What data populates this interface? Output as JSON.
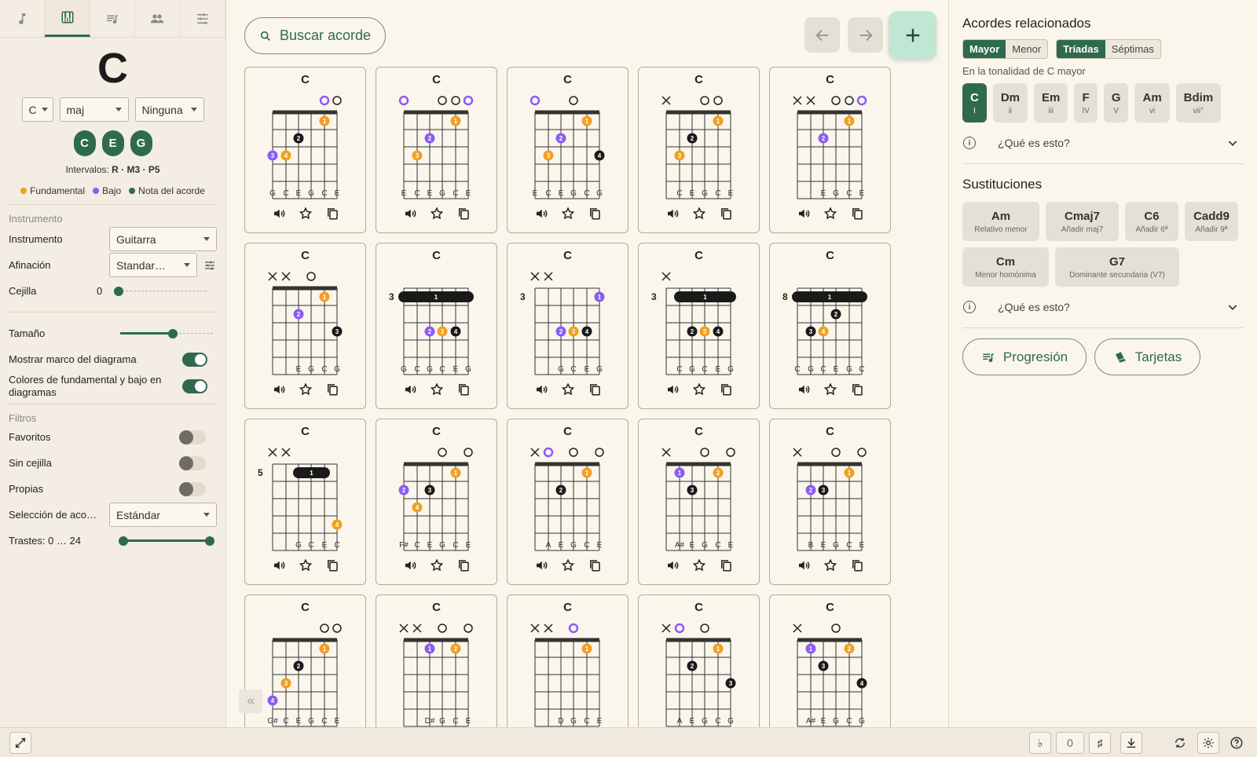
{
  "sidebar": {
    "chord_display": "C",
    "root_select": "C",
    "quality_select": "maj",
    "bass_select": "Ninguna",
    "chord_notes": [
      "C",
      "E",
      "G"
    ],
    "intervals_label": "Intervalos:",
    "intervals_value": "R · M3 · P5",
    "legend": {
      "root": "Fundamental",
      "bass": "Bajo",
      "note": "Nota del acorde"
    },
    "section_instrument": "Instrumento",
    "instrument_label": "Instrumento",
    "instrument_value": "Guitarra",
    "tuning_label": "Afinación",
    "tuning_value": "Standar…",
    "capo_label": "Cejilla",
    "capo_value": "0",
    "size_label": "Tamaño",
    "size_level": 0.57,
    "show_frame_label": "Mostrar marco del diagrama",
    "show_frame": true,
    "colors_label": "Colores de fundamental y bajo en diagramas",
    "colors_on": true,
    "section_filters": "Filtros",
    "favorites_label": "Favoritos",
    "favorites": false,
    "no_barre_label": "Sin cejilla",
    "no_barre": false,
    "own_label": "Propias",
    "own": false,
    "selection_label": "Selección de aco…",
    "selection_value": "Estándar",
    "frets_label": "Trastes: 0 … 24",
    "frets_range": [
      0,
      24
    ]
  },
  "toolbar": {
    "search_label": "Buscar acorde",
    "back_icon": "arrow-left-icon",
    "forward_icon": "arrow-right-icon",
    "add_icon": "plus-icon"
  },
  "colors": {
    "accent": "#2f6a4f",
    "root": "#f0a020",
    "bass": "#8b5cf6",
    "note": "#1a1a1a",
    "background": "#fbf6ec"
  },
  "diagrams": [
    {
      "name": "C",
      "base_fret": null,
      "markers": [
        "",
        "",
        "",
        "",
        "o",
        "o"
      ],
      "bass_open": 4,
      "barre": null,
      "dots": [
        [
          5,
          1,
          1,
          "r"
        ],
        [
          3,
          2,
          2,
          "n"
        ],
        [
          1,
          3,
          3,
          "b"
        ],
        [
          2,
          3,
          4,
          "r"
        ]
      ],
      "notes": [
        "G",
        "C",
        "E",
        "G",
        "C",
        "E"
      ]
    },
    {
      "name": "C",
      "base_fret": null,
      "markers": [
        "o",
        "",
        "",
        "o",
        "o",
        ""
      ],
      "bass_open": 0,
      "bass_open2": 5,
      "barre": null,
      "dots": [
        [
          5,
          1,
          1,
          "r"
        ],
        [
          3,
          2,
          2,
          "b"
        ],
        [
          2,
          3,
          3,
          "r"
        ]
      ],
      "notes": [
        "E",
        "C",
        "E",
        "G",
        "C",
        "E"
      ]
    },
    {
      "name": "C",
      "base_fret": null,
      "markers": [
        "o",
        "",
        "",
        "o",
        "",
        ""
      ],
      "bass_open": 0,
      "barre": null,
      "dots": [
        [
          5,
          1,
          1,
          "r"
        ],
        [
          3,
          2,
          2,
          "b"
        ],
        [
          2,
          3,
          3,
          "r"
        ],
        [
          6,
          3,
          4,
          "n"
        ]
      ],
      "notes": [
        "E",
        "C",
        "E",
        "G",
        "C",
        "G"
      ]
    },
    {
      "name": "C",
      "base_fret": null,
      "markers": [
        "x",
        "",
        "",
        "o",
        "o",
        ""
      ],
      "barre": null,
      "dots": [
        [
          5,
          1,
          1,
          "r"
        ],
        [
          3,
          2,
          2,
          "n"
        ],
        [
          2,
          3,
          3,
          "r"
        ]
      ],
      "notes": [
        "",
        "C",
        "E",
        "G",
        "C",
        "E"
      ]
    },
    {
      "name": "C",
      "base_fret": null,
      "markers": [
        "x",
        "x",
        "",
        "o",
        "o",
        ""
      ],
      "bass_open": 5,
      "barre": null,
      "dots": [
        [
          5,
          1,
          1,
          "r"
        ],
        [
          3,
          2,
          2,
          "b"
        ]
      ],
      "notes": [
        "",
        "",
        "E",
        "G",
        "C",
        "E"
      ]
    },
    {
      "name": "C",
      "base_fret": null,
      "markers": [
        "x",
        "x",
        "",
        "o",
        "",
        ""
      ],
      "barre": null,
      "dots": [
        [
          5,
          1,
          1,
          "r"
        ],
        [
          3,
          2,
          2,
          "b"
        ],
        [
          6,
          3,
          3,
          "n"
        ]
      ],
      "notes": [
        "",
        "",
        "E",
        "G",
        "C",
        "G"
      ]
    },
    {
      "name": "C",
      "base_fret": 3,
      "markers": [
        "",
        "",
        "",
        "",
        "",
        ""
      ],
      "barre": [
        1,
        1,
        6
      ],
      "dots": [
        [
          3,
          3,
          2,
          "b"
        ],
        [
          4,
          3,
          3,
          "r"
        ],
        [
          5,
          3,
          4,
          "n"
        ]
      ],
      "notes": [
        "G",
        "C",
        "G",
        "C",
        "E",
        "G"
      ]
    },
    {
      "name": "C",
      "base_fret": 3,
      "markers": [
        "x",
        "x",
        "",
        "",
        "",
        ""
      ],
      "barre": null,
      "dots": [
        [
          6,
          1,
          1,
          "b"
        ],
        [
          3,
          3,
          2,
          "b"
        ],
        [
          4,
          3,
          3,
          "r"
        ],
        [
          5,
          3,
          4,
          "n"
        ]
      ],
      "notes": [
        "",
        "",
        "G",
        "C",
        "E",
        "G"
      ]
    },
    {
      "name": "C",
      "base_fret": 3,
      "markers": [
        "x",
        "",
        "",
        "",
        "",
        ""
      ],
      "barre": [
        1,
        2,
        6
      ],
      "dots": [
        [
          3,
          3,
          2,
          "n"
        ],
        [
          4,
          3,
          3,
          "r"
        ],
        [
          5,
          3,
          4,
          "n"
        ]
      ],
      "notes": [
        "",
        "C",
        "G",
        "C",
        "E",
        "G"
      ]
    },
    {
      "name": "C",
      "base_fret": 8,
      "markers": [
        "",
        "",
        "",
        "",
        "",
        ""
      ],
      "barre": [
        1,
        1,
        6
      ],
      "dots": [
        [
          4,
          2,
          2,
          "n"
        ],
        [
          2,
          3,
          3,
          "n"
        ],
        [
          3,
          3,
          4,
          "r"
        ]
      ],
      "notes": [
        "C",
        "G",
        "C",
        "E",
        "G",
        "C"
      ]
    },
    {
      "name": "C",
      "base_fret": 5,
      "markers": [
        "x",
        "x",
        "",
        "",
        "",
        ""
      ],
      "barre": [
        1,
        3,
        5
      ],
      "dots": [
        [
          6,
          4,
          4,
          "r"
        ]
      ],
      "notes": [
        "",
        "",
        "G",
        "C",
        "E",
        "C"
      ]
    },
    {
      "name": "C",
      "base_fret": null,
      "markers": [
        "",
        "",
        "",
        "o",
        "",
        "o"
      ],
      "barre": null,
      "dots": [
        [
          5,
          1,
          1,
          "r"
        ],
        [
          1,
          2,
          2,
          "b"
        ],
        [
          3,
          2,
          3,
          "n"
        ],
        [
          2,
          3,
          4,
          "r"
        ]
      ],
      "notes": [
        "F#",
        "C",
        "E",
        "G",
        "C",
        "E"
      ]
    },
    {
      "name": "C",
      "base_fret": null,
      "markers": [
        "x",
        "",
        "",
        "o",
        "",
        "o"
      ],
      "bass_open": 1,
      "barre": null,
      "dots": [
        [
          5,
          1,
          1,
          "r"
        ],
        [
          3,
          2,
          2,
          "n"
        ]
      ],
      "notes": [
        "",
        "A",
        "E",
        "G",
        "C",
        "E"
      ]
    },
    {
      "name": "C",
      "base_fret": null,
      "markers": [
        "x",
        "",
        "",
        "o",
        "",
        "o"
      ],
      "barre": null,
      "dots": [
        [
          2,
          1,
          1,
          "b"
        ],
        [
          5,
          1,
          2,
          "r"
        ],
        [
          3,
          2,
          3,
          "n"
        ]
      ],
      "notes": [
        "",
        "A#",
        "E",
        "G",
        "C",
        "E"
      ]
    },
    {
      "name": "C",
      "base_fret": null,
      "markers": [
        "x",
        "",
        "",
        "o",
        "",
        "o"
      ],
      "barre": null,
      "dots": [
        [
          5,
          1,
          1,
          "r"
        ],
        [
          2,
          2,
          2,
          "b"
        ],
        [
          3,
          2,
          3,
          "n"
        ]
      ],
      "notes": [
        "",
        "B",
        "E",
        "G",
        "C",
        "E"
      ]
    },
    {
      "name": "C",
      "base_fret": null,
      "markers": [
        "",
        "",
        "",
        "",
        "o",
        "o"
      ],
      "barre": null,
      "dots": [
        [
          5,
          1,
          1,
          "r"
        ],
        [
          3,
          2,
          2,
          "n"
        ],
        [
          2,
          3,
          3,
          "r"
        ],
        [
          1,
          4,
          4,
          "b"
        ]
      ],
      "notes": [
        "G#",
        "C",
        "E",
        "G",
        "C",
        "E"
      ]
    },
    {
      "name": "C",
      "base_fret": null,
      "markers": [
        "x",
        "x",
        "",
        "o",
        "",
        "o"
      ],
      "barre": null,
      "dots": [
        [
          3,
          1,
          1,
          "b"
        ],
        [
          5,
          1,
          2,
          "r"
        ]
      ],
      "notes": [
        "",
        "",
        "D#",
        "G",
        "C",
        "E"
      ]
    },
    {
      "name": "C",
      "base_fret": null,
      "markers": [
        "x",
        "x",
        "",
        "o",
        "",
        ""
      ],
      "bass_open": 3,
      "barre": null,
      "dots": [
        [
          5,
          1,
          1,
          "r"
        ]
      ],
      "notes": [
        "",
        "",
        "D",
        "G",
        "C",
        "E"
      ]
    },
    {
      "name": "C",
      "base_fret": null,
      "markers": [
        "x",
        "",
        "",
        "o",
        "",
        ""
      ],
      "bass_open": 1,
      "barre": null,
      "dots": [
        [
          5,
          1,
          1,
          "r"
        ],
        [
          3,
          2,
          2,
          "n"
        ],
        [
          6,
          3,
          3,
          "n"
        ]
      ],
      "notes": [
        "",
        "A",
        "E",
        "G",
        "C",
        "G"
      ]
    },
    {
      "name": "C",
      "base_fret": null,
      "markers": [
        "x",
        "",
        "",
        "o",
        "",
        ""
      ],
      "barre": null,
      "dots": [
        [
          2,
          1,
          1,
          "b"
        ],
        [
          5,
          1,
          2,
          "r"
        ],
        [
          3,
          2,
          3,
          "n"
        ],
        [
          6,
          3,
          4,
          "n"
        ]
      ],
      "notes": [
        "",
        "A#",
        "E",
        "G",
        "C",
        "G"
      ]
    }
  ],
  "right": {
    "related_title": "Acordes relacionados",
    "seg_mode": [
      "Mayor",
      "Menor"
    ],
    "seg_type": [
      "Tríadas",
      "Séptimas"
    ],
    "key_label": "En la tonalidad de C mayor",
    "related": [
      {
        "name": "C",
        "deg": "I",
        "active": true
      },
      {
        "name": "Dm",
        "deg": "ii"
      },
      {
        "name": "Em",
        "deg": "iii"
      },
      {
        "name": "F",
        "deg": "IV"
      },
      {
        "name": "G",
        "deg": "V"
      },
      {
        "name": "Am",
        "deg": "vi"
      },
      {
        "name": "Bdim",
        "deg": "vii°"
      }
    ],
    "what_is": "¿Qué es esto?",
    "subs_title": "Sustituciones",
    "subs": [
      {
        "name": "Am",
        "desc": "Relativo menor"
      },
      {
        "name": "Cmaj7",
        "desc": "Añadir maj7"
      },
      {
        "name": "C6",
        "desc": "Añadir 6ª"
      },
      {
        "name": "Cadd9",
        "desc": "Añadir 9ª"
      },
      {
        "name": "Cm",
        "desc": "Menor homónima"
      },
      {
        "name": "G7",
        "desc": "Dominante secundaria (V7)"
      }
    ],
    "progression_button": "Progresión",
    "cards_button": "Tarjetas"
  },
  "bottombar": {
    "flat": "♭",
    "transpose": "0",
    "sharp": "♯"
  }
}
